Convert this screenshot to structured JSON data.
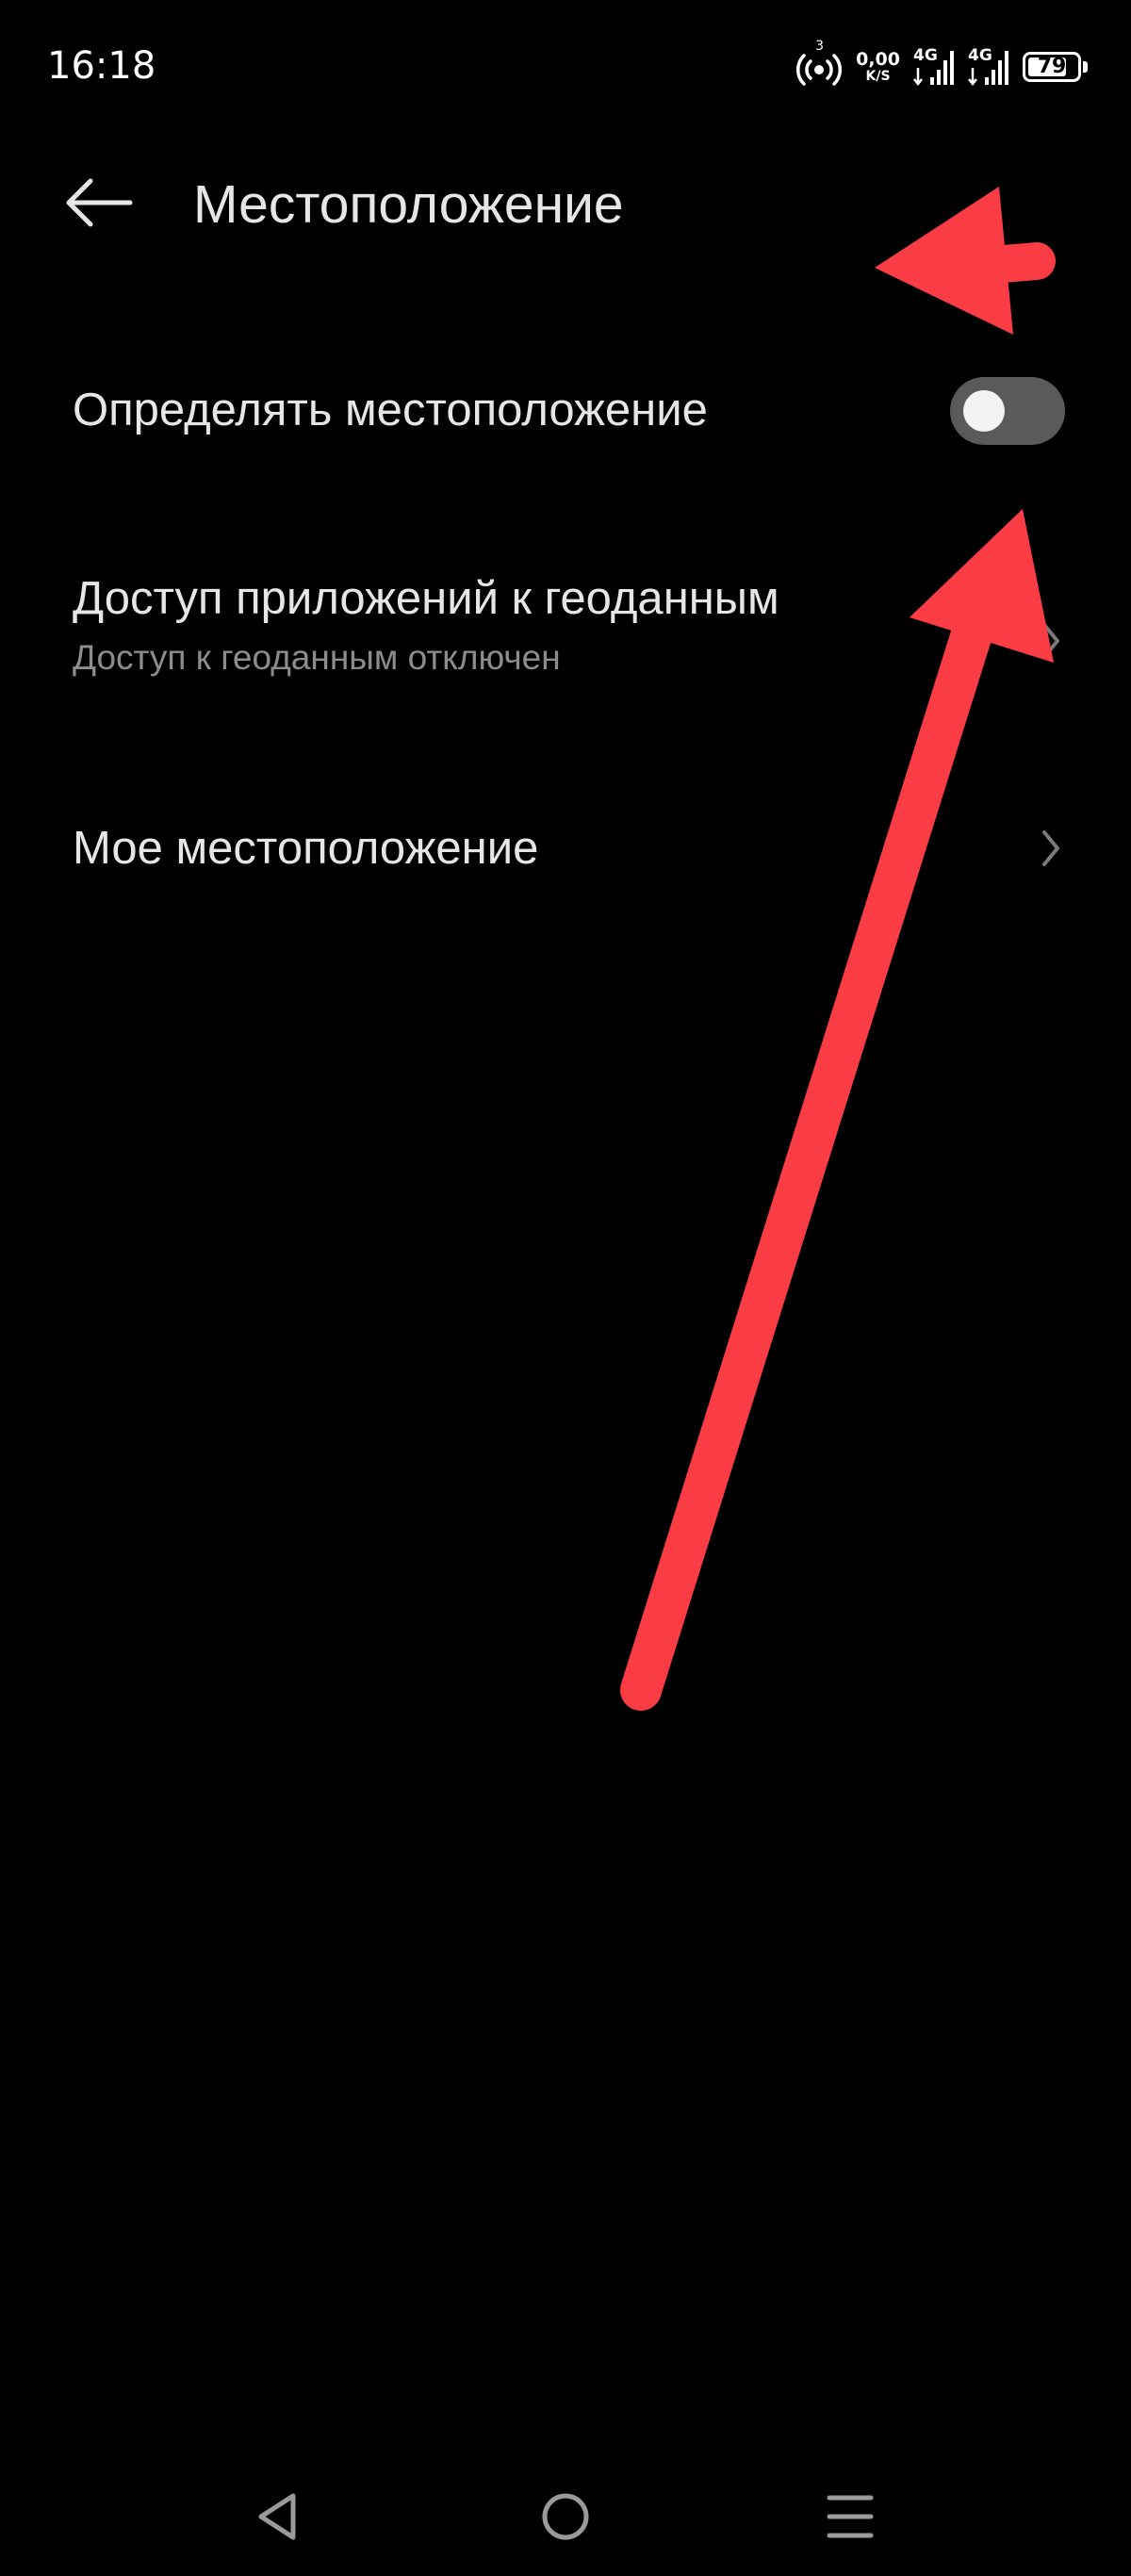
{
  "status_bar": {
    "time": "16:18",
    "hotspot_count": "3",
    "net_speed_value": "0,00",
    "net_speed_unit": "K/S",
    "network_1": "4G",
    "network_2": "4G",
    "battery_level": "79",
    "battery_fraction": 0.79
  },
  "header": {
    "title": "Местоположение",
    "back_icon": "arrow-left-icon"
  },
  "settings": {
    "location_toggle": {
      "label": "Определять местоположение",
      "enabled": false
    },
    "app_access": {
      "label": "Доступ приложений к геоданным",
      "subtitle": "Доступ к геоданным отключен"
    },
    "my_location": {
      "label": "Мое местоположение"
    }
  },
  "nav_bar": {
    "back_icon": "triangle-back-icon",
    "home_icon": "circle-home-icon",
    "recents_icon": "menu-lines-icon"
  },
  "colors": {
    "background": "#000000",
    "text_primary": "#e6e6e6",
    "text_secondary": "#8c8c8c",
    "toggle_off_track": "#5a5a5a",
    "annotation_arrow": "#fa3c44"
  }
}
